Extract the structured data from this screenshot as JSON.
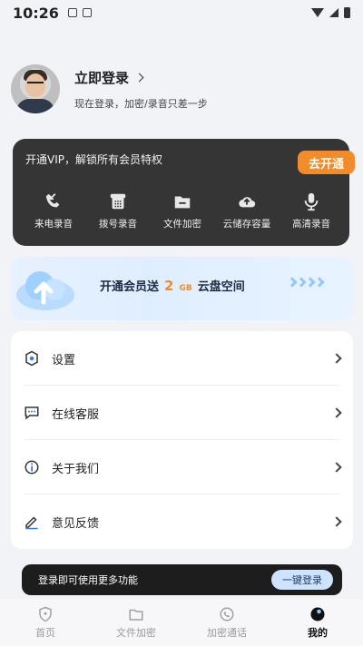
{
  "status_bar": {
    "time": "10:26"
  },
  "profile": {
    "title": "立即登录",
    "subtitle": "现在登录，加密/录音只差一步"
  },
  "vip_card": {
    "title": "开通VIP，解锁所有会员特权",
    "button_label": "去开通",
    "features": [
      {
        "icon": "incoming-call-icon",
        "label": "来电录音"
      },
      {
        "icon": "dial-phone-icon",
        "label": "拨号录音"
      },
      {
        "icon": "folder-lock-icon",
        "label": "文件加密"
      },
      {
        "icon": "cloud-upload-icon",
        "label": "云储存容量"
      },
      {
        "icon": "microphone-icon",
        "label": "高清录音"
      }
    ]
  },
  "cloud_banner": {
    "text_before": "开通会员送",
    "amount": "2",
    "unit": "GB",
    "text_after": "云盘空间"
  },
  "menu": {
    "items": [
      {
        "icon": "settings-icon",
        "label": "设置"
      },
      {
        "icon": "chat-support-icon",
        "label": "在线客服"
      },
      {
        "icon": "info-icon",
        "label": "关于我们"
      },
      {
        "icon": "feedback-edit-icon",
        "label": "意见反馈"
      }
    ]
  },
  "login_bar": {
    "text": "登录即可使用更多功能",
    "button_label": "一键登录"
  },
  "tabs": [
    {
      "icon": "home-shield-icon",
      "label": "首页"
    },
    {
      "icon": "folder-icon",
      "label": "文件加密"
    },
    {
      "icon": "phone-chat-icon",
      "label": "加密通话"
    },
    {
      "icon": "profile-icon",
      "label": "我的"
    }
  ],
  "colors": {
    "accent_orange": "#f28b2a",
    "vip_card_bg": "#353535",
    "page_bg": "#f2f3f7"
  }
}
